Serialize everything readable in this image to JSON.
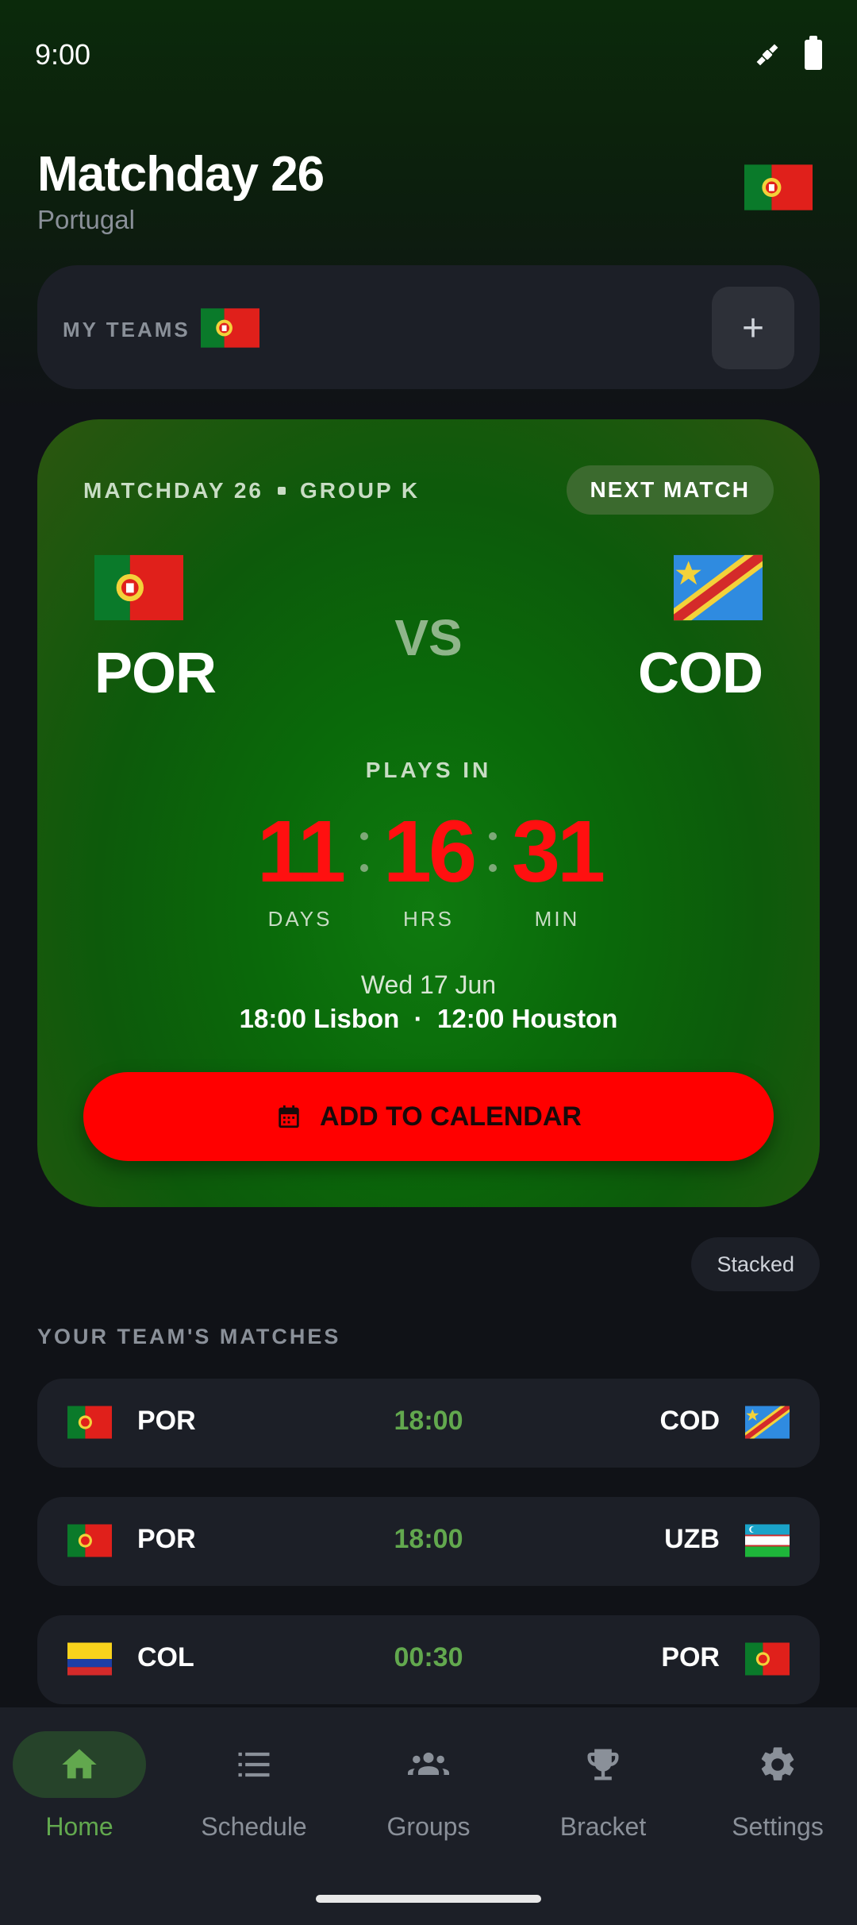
{
  "status_bar": {
    "time": "9:00"
  },
  "header": {
    "title": "Matchday 26",
    "subtitle": "Portugal"
  },
  "my_teams": {
    "label": "MY TEAMS",
    "add_label": "+"
  },
  "next_match": {
    "matchday": "MATCHDAY 26",
    "group": "GROUP K",
    "badge": "NEXT MATCH",
    "home_code": "POR",
    "away_code": "COD",
    "vs": "VS",
    "plays_in": "PLAYS IN",
    "countdown": {
      "days": "11",
      "hours": "16",
      "minutes": "31",
      "days_label": "DAYS",
      "hours_label": "HRS",
      "minutes_label": "MIN"
    },
    "date": "Wed 17 Jun",
    "times": "18:00 Lisbon  ·  12:00 Houston",
    "calendar_button": "ADD TO CALENDAR"
  },
  "view_toggle": "Stacked",
  "matches_section": {
    "title": "YOUR TEAM'S MATCHES",
    "rows": [
      {
        "home": "POR",
        "time": "18:00",
        "away": "COD"
      },
      {
        "home": "POR",
        "time": "18:00",
        "away": "UZB"
      },
      {
        "home": "COL",
        "time": "00:30",
        "away": "POR"
      }
    ]
  },
  "nav": {
    "items": [
      {
        "label": "Home",
        "icon": "home-icon"
      },
      {
        "label": "Schedule",
        "icon": "list-icon"
      },
      {
        "label": "Groups",
        "icon": "groups-icon"
      },
      {
        "label": "Bracket",
        "icon": "trophy-icon"
      },
      {
        "label": "Settings",
        "icon": "gear-icon"
      }
    ],
    "active": "Home"
  },
  "colors": {
    "accent_green": "#62a84e",
    "cta_red": "#ff0000",
    "countdown_red": "#ff1010",
    "surface": "#1c1f27",
    "background": "#101217"
  }
}
